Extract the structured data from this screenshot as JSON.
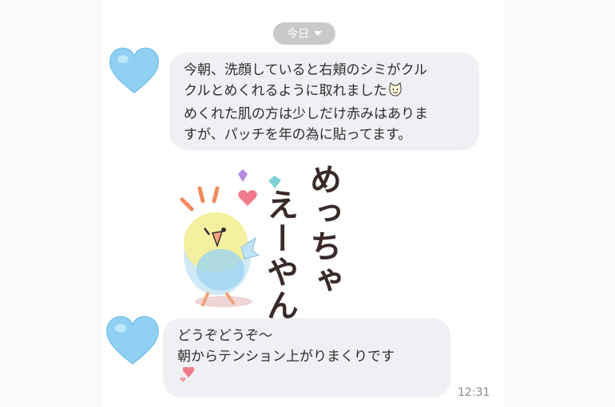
{
  "date_pill": {
    "label": "今日"
  },
  "messages": [
    {
      "lines": [
        "今朝、洗顔していると右頬のシミがクル",
        "クルとめくれるように取れました",
        "めくれた肌の方は少しだけ赤みはありま",
        "すが、パッチを年の為に貼ってます。"
      ],
      "inline_emoji": "cat-face-emoji"
    },
    {
      "sticker_text": [
        "めっちゃ",
        "えーやん"
      ]
    },
    {
      "lines": [
        "どうぞどうぞ～",
        "朝からテンション上がりまくりです"
      ],
      "inline_emoji": "two-hearts-emoji",
      "time": "12:31"
    }
  ],
  "colors": {
    "bubble": "#eef0f4",
    "avatar_heart": "#8fd0f3",
    "pill": "#c9c9c9"
  }
}
